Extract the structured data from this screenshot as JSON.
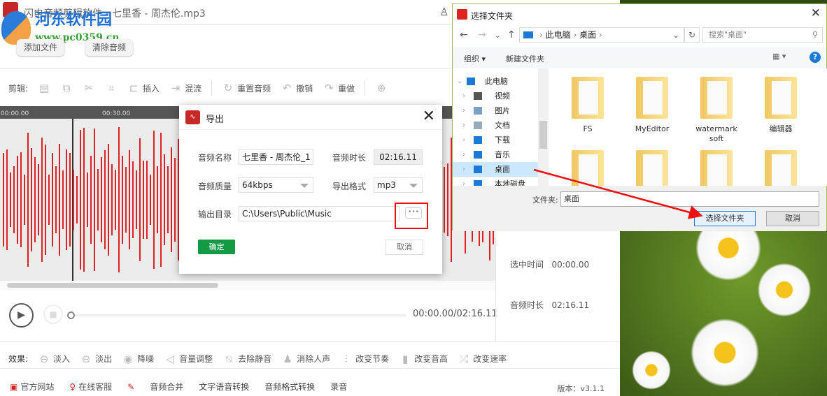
{
  "app": {
    "title": "闪电音频剪辑软件 - 七里香 - 周杰伦.mp3",
    "add_file": "添加文件",
    "clear_audio": "清除音频"
  },
  "watermark": {
    "name": "河东软件园",
    "url": "www.pc0359.cn"
  },
  "toolbar": {
    "label": "剪辑:",
    "insert": "插入",
    "mix": "混流",
    "reset": "重置音频",
    "undo": "撤销",
    "redo": "重做"
  },
  "timeline": {
    "ticks": [
      "00:00.00",
      "00:30.00"
    ]
  },
  "player": {
    "time": "00:00.00/02:16.11"
  },
  "side": {
    "sel_label": "选中时间",
    "sel_value": "00:00.00",
    "dur_label": "音频时长",
    "dur_value": "02:16.11"
  },
  "effects": {
    "label": "效果:",
    "items": [
      "淡入",
      "淡出",
      "降噪",
      "音量调整",
      "去除静音",
      "消除人声",
      "改变节奏",
      "改变音高",
      "改变速率"
    ]
  },
  "footer": {
    "items": [
      "官方网站",
      "在线客服",
      "音频合并",
      "文字语音转换",
      "音频格式转换",
      "录音"
    ],
    "version": "版本：v3.1.1"
  },
  "export": {
    "title": "导出",
    "name_label": "音频名称",
    "name_value": "七里香 - 周杰伦_1",
    "dur_label": "音频时长",
    "dur_value": "02:16.11",
    "quality_label": "音频质量",
    "quality_value": "64kbps",
    "format_label": "导出格式",
    "format_value": "mp3",
    "dir_label": "输出目录",
    "dir_value": "C:\\Users\\Public\\Music",
    "more": "•••",
    "ok": "确定",
    "cancel": "取消"
  },
  "folder_dialog": {
    "title": "选择文件夹",
    "path": [
      "此电脑",
      "桌面"
    ],
    "search_placeholder": "搜索\"桌面\"",
    "organize": "组织 ▾",
    "new_folder": "新建文件夹",
    "tree": [
      {
        "label": "此电脑",
        "color": "#1c7ad6"
      },
      {
        "label": "视频",
        "color": "#555"
      },
      {
        "label": "图片",
        "color": "#7aa0c8"
      },
      {
        "label": "文档",
        "color": "#9ab"
      },
      {
        "label": "下载",
        "color": "#1c7ad6"
      },
      {
        "label": "音乐",
        "color": "#1c7ad6"
      },
      {
        "label": "桌面",
        "color": "#1c7ad6"
      },
      {
        "label": "本地磁盘 (C:)",
        "color": "#1c7ad6"
      }
    ],
    "files": [
      "FS",
      "MyEditor",
      "watermarksoft",
      "编辑器",
      "",
      "",
      "",
      ""
    ],
    "folder_label": "文件夹:",
    "folder_value": "桌面",
    "select": "选择文件夹",
    "cancel": "取消"
  }
}
